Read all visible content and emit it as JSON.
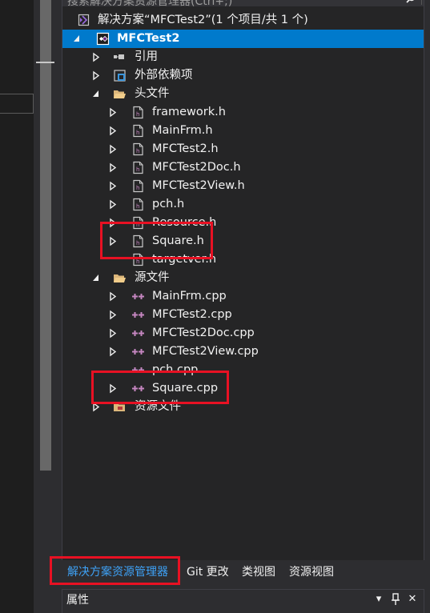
{
  "search": {
    "placeholder": "搜索解决方案资源管理器(Ctrl+;)"
  },
  "solution": {
    "label": "解决方案“MFCTest2”(1 个项目/共 1 个)"
  },
  "project": {
    "label": "MFCTest2"
  },
  "nodes": {
    "references": "引用",
    "external_deps": "外部依赖项",
    "header_files": "头文件",
    "source_files": "源文件",
    "resource_files": "资源文件"
  },
  "headers": [
    "framework.h",
    "MainFrm.h",
    "MFCTest2.h",
    "MFCTest2Doc.h",
    "MFCTest2View.h",
    "pch.h",
    "Resource.h",
    "Square.h",
    "targetver.h"
  ],
  "sources": [
    "MainFrm.cpp",
    "MFCTest2.cpp",
    "MFCTest2Doc.cpp",
    "MFCTest2View.cpp",
    "pch.cpp",
    "Square.cpp"
  ],
  "tabs": {
    "solution_explorer": "解决方案资源管理器",
    "git_changes": "Git 更改",
    "class_view": "类视图",
    "resource_view": "资源视图"
  },
  "properties": {
    "title": "属性",
    "dropdown_glyph": "▾",
    "pin_glyph": "📌",
    "close_glyph": "✕"
  },
  "colors": {
    "selection": "#007acc",
    "highlight_box": "#e81123",
    "active_tab": "#3ea2f7",
    "cpp_icon": "#c586c0"
  }
}
